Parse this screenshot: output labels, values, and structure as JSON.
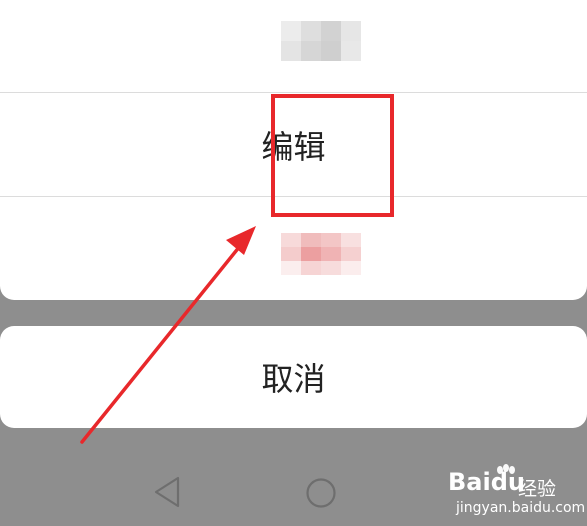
{
  "action_sheet": {
    "items": [
      {
        "label": "",
        "blurred": true
      },
      {
        "label": "编辑",
        "blurred": false
      },
      {
        "label": "",
        "blurred": true
      }
    ],
    "cancel_label": "取消"
  },
  "colors": {
    "overlay": "#8e8e8e",
    "sheet": "#ffffff",
    "highlight": "#e8282b",
    "text": "#222222"
  },
  "nav_bar": {
    "icons": [
      "back-triangle-icon",
      "home-circle-icon"
    ]
  },
  "watermark": {
    "brand": "Bai",
    "brand_suffix": "du",
    "name": "经验",
    "url": "jingyan.baidu.com"
  }
}
